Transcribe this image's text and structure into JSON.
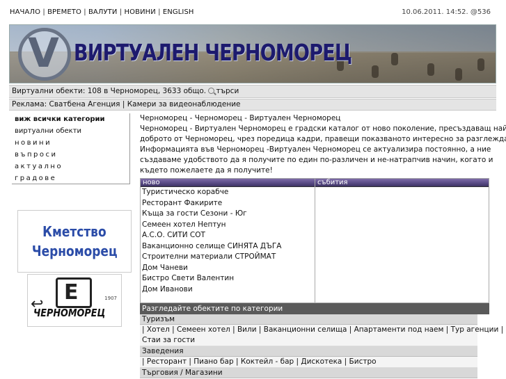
{
  "topnav": {
    "items": [
      "НАЧАЛО",
      "ВРЕМЕТО",
      "ВАЛУТИ",
      "НОВИНИ",
      "ENGLISH"
    ],
    "separator": " | "
  },
  "datestamp": "10.06.2011. 14:52. @536",
  "banner": {
    "title": "ВИРТУАЛЕН ЧЕРНОМОРЕЦ",
    "logo_letter": "V",
    "colors": {
      "title": "#1d1a6e",
      "logo": "#5a6478"
    }
  },
  "objects_bar": {
    "text": "Виртуални обекти:  108 в Черноморец, 3633 общо.",
    "search_icon": "magnifier-icon",
    "search_label": "търси"
  },
  "ads_bar": {
    "prefix": "Реклама:",
    "links": [
      "Сватбена Агенция",
      "Камери за видеонаблюдение"
    ]
  },
  "leftmenu": {
    "items": [
      {
        "label": "виж всички категории",
        "style": "bold"
      },
      {
        "label": "виртуални обекти",
        "style": "normal"
      },
      {
        "label": "новини",
        "style": "spaced"
      },
      {
        "label": "въпроси",
        "style": "spaced"
      },
      {
        "label": "актуално",
        "style": "spaced"
      },
      {
        "label": "градове",
        "style": "spaced"
      }
    ]
  },
  "kmetstvo": {
    "line1": "Кметство",
    "line2": "Черноморец",
    "color": "#2b4ca8"
  },
  "chlogo": {
    "word": "ЧЕРНОМОРЕЦ",
    "year": "1907"
  },
  "intro": {
    "lines": [
      "Черноморец - Черноморец - Виртуален Черноморец",
      "Черноморец - Виртуален Черноморец е градски каталог от ново поколение, пресъздаващ най-",
      "доброто от Черноморец, чрез поредица кадри, правещи показваното интересно за разглеждане.",
      "Информацията във Черноморец -Виртуален Черноморец се актуализира постоянно, а ние",
      "създаваме удобството да я получите по един по-различен и не-натрапчив начин, когато и",
      "където пожелаете да я получите!"
    ]
  },
  "new_column": {
    "header": "ново",
    "items": [
      "Туристическо корабче",
      "Ресторант Факирите",
      "Къща за гости Сезони - Юг",
      "Семеен хотел Нептун",
      "А.С.О. СИТИ СОТ",
      "Ваканционно селище СИНЯТА ДЪГА",
      "Строителни материали СТРОЙМАТ",
      "Дом Чаневи",
      "Бистро Свети Валентин",
      "Дом Иванови"
    ]
  },
  "events_column": {
    "header": "събития"
  },
  "categories": {
    "header": "Разгледайте обектите по категории",
    "groups": [
      {
        "name": "Туризъм",
        "rows": [
          "| Хотел | Семеен хотел  | Вили | Ваканционни селища | Апартаменти под наем | Тур агенции |",
          "  Стаи за гости"
        ]
      },
      {
        "name": "Заведения",
        "rows": [
          "| Ресторант | Пиано бар | Коктейл - бар | Дискотека | Бистро"
        ]
      },
      {
        "name": "Търговия / Магазини",
        "rows": []
      }
    ]
  }
}
